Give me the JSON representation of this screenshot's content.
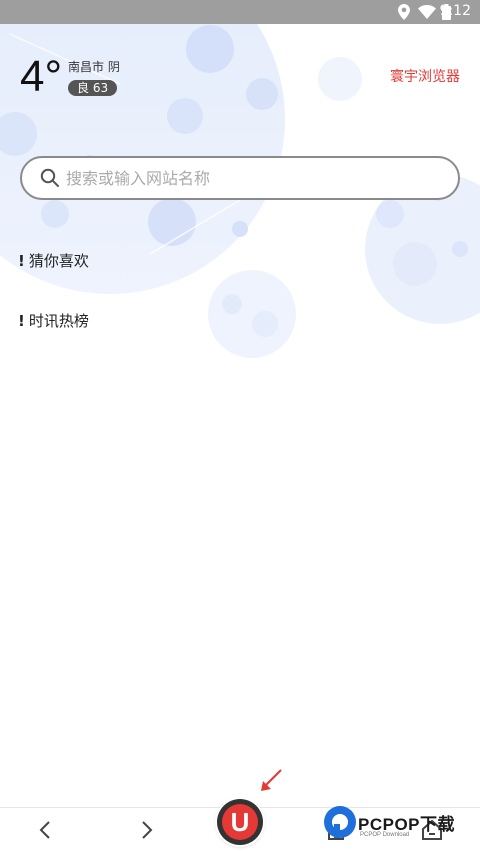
{
  "status_bar": {
    "time": "9:12",
    "icons": [
      "location-icon",
      "wifi-icon",
      "battery-icon"
    ]
  },
  "weather": {
    "temperature": "4°",
    "city_condition": "南昌市 阴",
    "aqi": "良 63"
  },
  "brand_link": "寰宇浏览器",
  "search": {
    "placeholder": "搜索或输入网站名称",
    "value": ""
  },
  "sections": [
    {
      "mark": "!",
      "title": "猜你喜欢"
    },
    {
      "mark": "!",
      "title": "时讯热榜"
    }
  ],
  "bottom_nav": {
    "items": [
      "back-icon",
      "forward-icon",
      "home-u-button",
      "tabs-icon",
      "home-icon"
    ],
    "center_label": "U"
  },
  "watermark": {
    "text": "PCPOP下载",
    "sub": "PCPOP Download"
  },
  "colors": {
    "accent": "#e53935",
    "status_bar": "#9e9e9e",
    "decor_blue": "#dfe9fb"
  }
}
